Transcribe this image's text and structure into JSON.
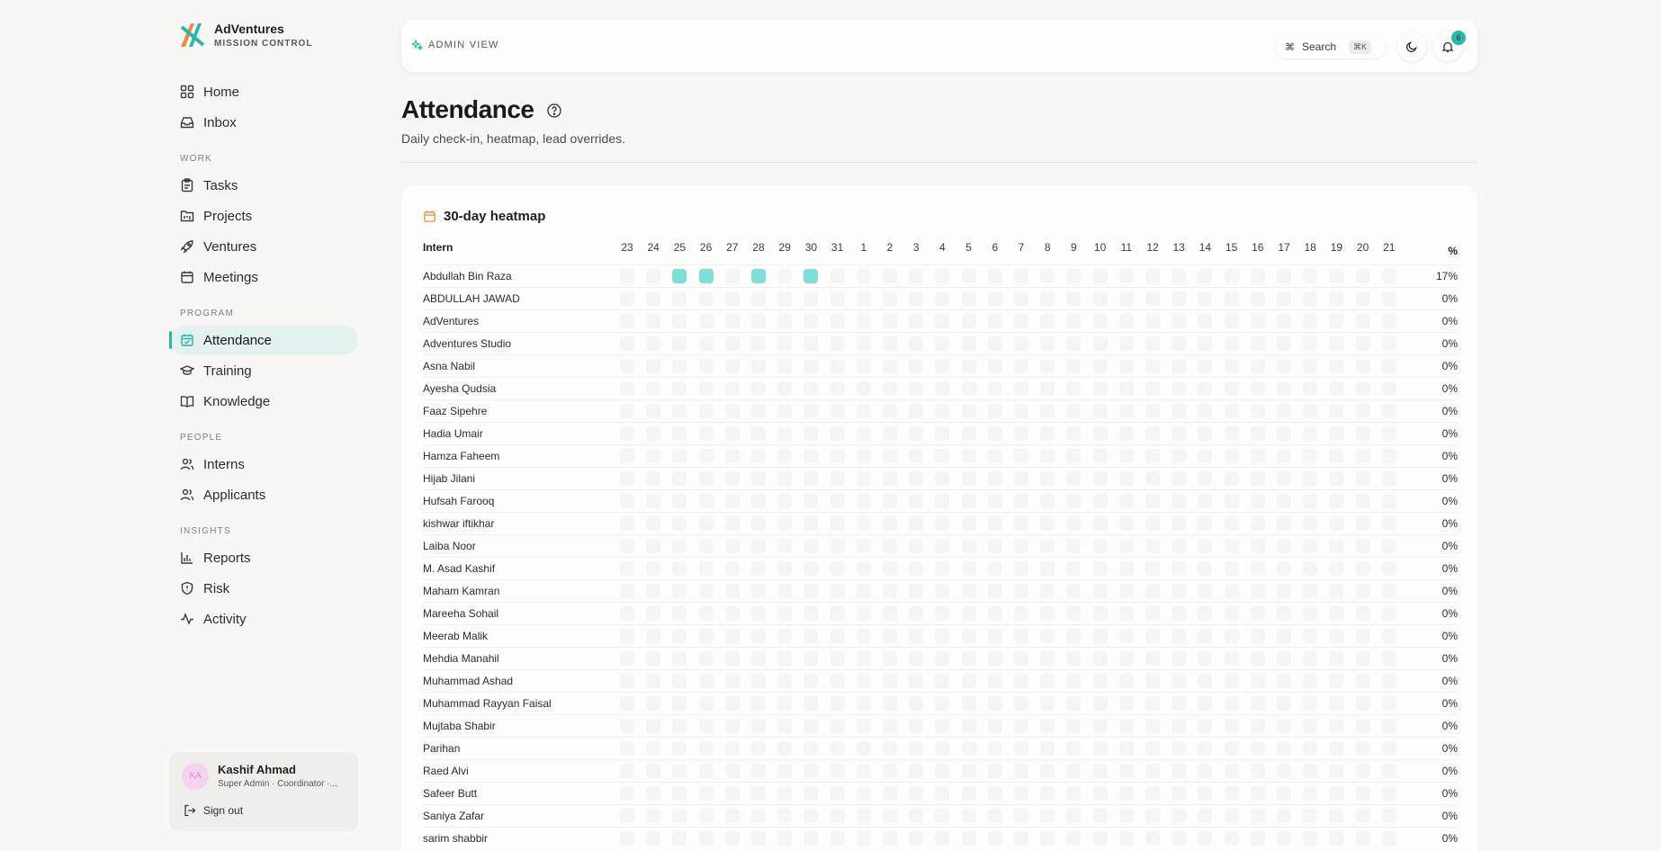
{
  "brand": {
    "name": "AdVentures",
    "subtitle": "MISSION CONTROL"
  },
  "nav": {
    "top": [
      {
        "label": "Home",
        "icon": "grid-icon"
      },
      {
        "label": "Inbox",
        "icon": "inbox-icon"
      }
    ],
    "sections": [
      {
        "title": "WORK",
        "items": [
          {
            "label": "Tasks",
            "icon": "clipboard-icon"
          },
          {
            "label": "Projects",
            "icon": "kanban-icon"
          },
          {
            "label": "Ventures",
            "icon": "rocket-icon"
          },
          {
            "label": "Meetings",
            "icon": "calendar-icon"
          }
        ]
      },
      {
        "title": "PROGRAM",
        "items": [
          {
            "label": "Attendance",
            "icon": "calendar-check-icon",
            "active": true
          },
          {
            "label": "Training",
            "icon": "graduation-cap-icon"
          },
          {
            "label": "Knowledge",
            "icon": "book-icon"
          }
        ]
      },
      {
        "title": "PEOPLE",
        "items": [
          {
            "label": "Interns",
            "icon": "users-icon"
          },
          {
            "label": "Applicants",
            "icon": "users-icon"
          }
        ]
      },
      {
        "title": "INSIGHTS",
        "items": [
          {
            "label": "Reports",
            "icon": "bar-chart-icon"
          },
          {
            "label": "Risk",
            "icon": "shield-icon"
          },
          {
            "label": "Activity",
            "icon": "activity-icon"
          }
        ]
      }
    ]
  },
  "user": {
    "initials": "KA",
    "name": "Kashif Ahmad",
    "role": "Super Admin · Coordinator ·...",
    "signout": "Sign out"
  },
  "topbar": {
    "mode": "ADMIN VIEW",
    "search_label": "Search",
    "search_kbd": "⌘K",
    "notifications": "6"
  },
  "page": {
    "title": "Attendance",
    "subtitle": "Daily check-in, heatmap, lead overrides."
  },
  "heatmap": {
    "title": "30-day heatmap",
    "intern_header": "Intern",
    "pct_header": "%",
    "days": [
      "23",
      "24",
      "25",
      "26",
      "27",
      "28",
      "29",
      "30",
      "31",
      "1",
      "2",
      "3",
      "4",
      "5",
      "6",
      "7",
      "8",
      "9",
      "10",
      "11",
      "12",
      "13",
      "14",
      "15",
      "16",
      "17",
      "18",
      "19",
      "20",
      "21"
    ],
    "rows": [
      {
        "name": "Abdullah Bin Raza",
        "pct": "17%",
        "present": [
          2,
          3,
          5,
          7
        ]
      },
      {
        "name": "ABDULLAH JAWAD",
        "pct": "0%",
        "present": []
      },
      {
        "name": "AdVentures",
        "pct": "0%",
        "present": []
      },
      {
        "name": "Adventures Studio",
        "pct": "0%",
        "present": []
      },
      {
        "name": "Asna Nabil",
        "pct": "0%",
        "present": []
      },
      {
        "name": "Ayesha Qudsia",
        "pct": "0%",
        "present": []
      },
      {
        "name": "Faaz Sipehre",
        "pct": "0%",
        "present": []
      },
      {
        "name": "Hadia Umair",
        "pct": "0%",
        "present": []
      },
      {
        "name": "Hamza Faheem",
        "pct": "0%",
        "present": []
      },
      {
        "name": "Hijab Jilani",
        "pct": "0%",
        "present": []
      },
      {
        "name": "Hufsah Farooq",
        "pct": "0%",
        "present": []
      },
      {
        "name": "kishwar iftikhar",
        "pct": "0%",
        "present": []
      },
      {
        "name": "Laiba Noor",
        "pct": "0%",
        "present": []
      },
      {
        "name": "M. Asad Kashif",
        "pct": "0%",
        "present": []
      },
      {
        "name": "Maham Kamran",
        "pct": "0%",
        "present": []
      },
      {
        "name": "Mareeha Sohail",
        "pct": "0%",
        "present": []
      },
      {
        "name": "Meerab Malik",
        "pct": "0%",
        "present": []
      },
      {
        "name": "Mehdia Manahil",
        "pct": "0%",
        "present": []
      },
      {
        "name": "Muhammad Ashad",
        "pct": "0%",
        "present": []
      },
      {
        "name": "Muhammad Rayyan Faisal",
        "pct": "0%",
        "present": []
      },
      {
        "name": "Mujtaba Shabir",
        "pct": "0%",
        "present": []
      },
      {
        "name": "Parihan",
        "pct": "0%",
        "present": []
      },
      {
        "name": "Raed Alvi",
        "pct": "0%",
        "present": []
      },
      {
        "name": "Safeer Butt",
        "pct": "0%",
        "present": []
      },
      {
        "name": "Saniya Zafar",
        "pct": "0%",
        "present": []
      },
      {
        "name": "sarim shabbir",
        "pct": "0%",
        "present": []
      }
    ]
  },
  "colors": {
    "accent": "#2bb8a8",
    "present": "#7fded5",
    "empty": "#f6f5f2",
    "calendar_icon": "#f08a3c"
  }
}
